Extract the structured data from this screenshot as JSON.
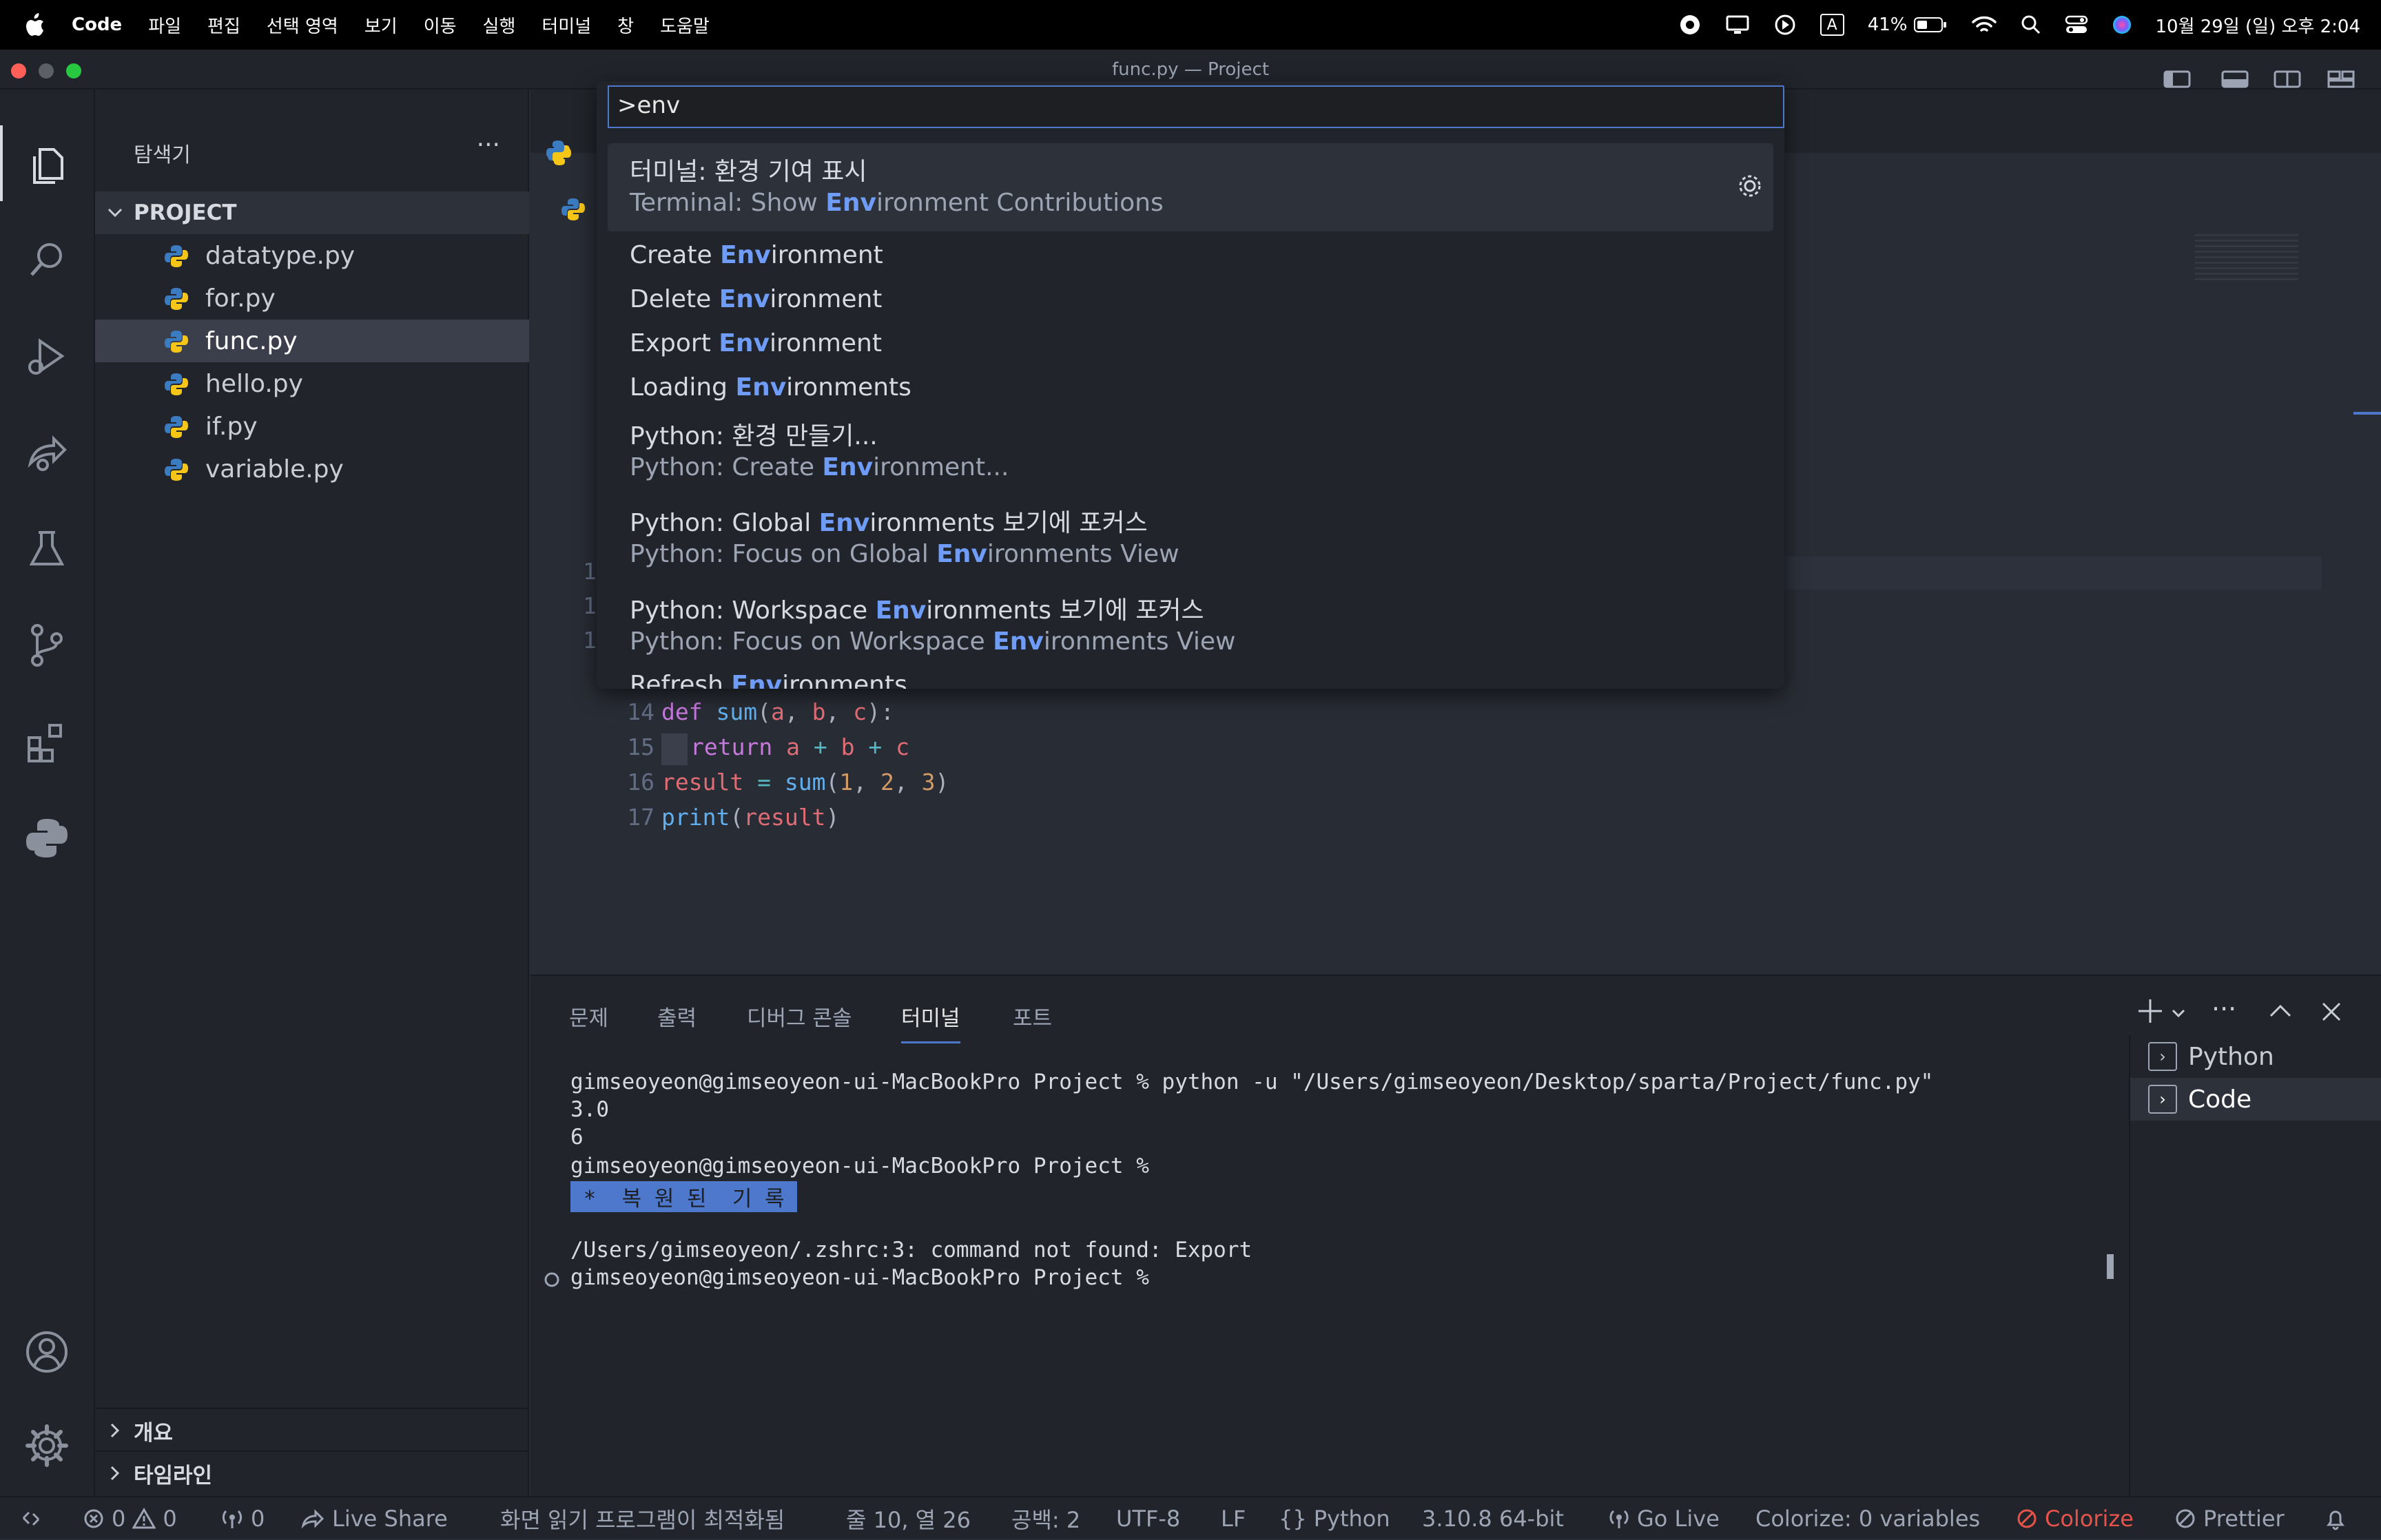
{
  "menubar": {
    "app": "Code",
    "items": [
      "파일",
      "편집",
      "선택 영역",
      "보기",
      "이동",
      "실행",
      "터미널",
      "창",
      "도움말"
    ],
    "input_indicator": "A",
    "battery": "41%",
    "datetime": "10월 29일 (일) 오후 2:04"
  },
  "window": {
    "title": "func.py — Project"
  },
  "sidebar": {
    "title": "탐색기",
    "more": "···",
    "project": "PROJECT",
    "files": [
      "datatype.py",
      "for.py",
      "func.py",
      "hello.py",
      "if.py",
      "variable.py"
    ],
    "active_file": "func.py",
    "sections": [
      "개요",
      "타임라인"
    ]
  },
  "editor": {
    "lines": [
      {
        "num": "1",
        "partial": true
      },
      {
        "num": "1",
        "partial": true
      },
      {
        "num": "1",
        "partial": true
      },
      {
        "num": "14"
      },
      {
        "num": "15"
      },
      {
        "num": "16"
      },
      {
        "num": "17"
      }
    ]
  },
  "palette": {
    "query": ">env",
    "items": [
      {
        "pre": "터미널: 환경 기여 표시",
        "sub_pre": "Terminal: Show ",
        "sub_hl": "Env",
        "sub_post": "ironment Contributions",
        "selected": true
      },
      {
        "pre": "Create ",
        "hl": "Env",
        "post": "ironment"
      },
      {
        "pre": "Delete ",
        "hl": "Env",
        "post": "ironment"
      },
      {
        "pre": "Export ",
        "hl": "Env",
        "post": "ironment"
      },
      {
        "pre": "Loading ",
        "hl": "Env",
        "post": "ironments"
      },
      {
        "pre": "Python: 환경 만들기...",
        "sub_pre": "Python: Create ",
        "sub_hl": "Env",
        "sub_post": "ironment..."
      },
      {
        "pre": "Python: Global ",
        "hl": "Env",
        "post": "ironments 보기에 포커스",
        "sub_pre": "Python: Focus on Global ",
        "sub_hl": "Env",
        "sub_post": "ironments View"
      },
      {
        "pre": "Python: Workspace ",
        "hl": "Env",
        "post": "ironments 보기에 포커스",
        "sub_pre": "Python: Focus on Workspace ",
        "sub_hl": "Env",
        "sub_post": "ironments View"
      },
      {
        "pre": "Refresh ",
        "hl": "Env",
        "post": "ironments"
      }
    ]
  },
  "panel": {
    "tabs": [
      "문제",
      "출력",
      "디버그 콘솔",
      "터미널",
      "포트"
    ],
    "active_tab": "터미널",
    "terminal_lines": [
      "gimseoyeon@gimseoyeon-ui-MacBookPro Project % python -u \"/Users/gimseoyeon/Desktop/sparta/Project/func.py\"",
      "3.0",
      "6",
      "gimseoyeon@gimseoyeon-ui-MacBookPro Project %",
      " *  복 원 된  기 록 ",
      "",
      "/Users/gimseoyeon/.zshrc:3: command not found: Export",
      "gimseoyeon@gimseoyeon-ui-MacBookPro Project %"
    ],
    "terminals": [
      "Python",
      "Code"
    ],
    "active_terminal": "Code"
  },
  "status": {
    "errors": "0",
    "warnings": "0",
    "ports": "0",
    "live_share": "Live Share",
    "screen_reader": "화면 읽기 프로그램이 최적화됨",
    "position": "줄 10, 열 26",
    "spaces": "공백: 2",
    "encoding": "UTF-8",
    "eol": "LF",
    "language": "Python",
    "interpreter": "3.10.8 64-bit",
    "go_live": "Go Live",
    "colorize_vars": "Colorize: 0 variables",
    "colorize": "Colorize",
    "prettier": "Prettier"
  },
  "colors": {
    "accent": "#4d78cc",
    "highlight": "#6e9cf7",
    "colorize_warning": "#e5534b"
  }
}
